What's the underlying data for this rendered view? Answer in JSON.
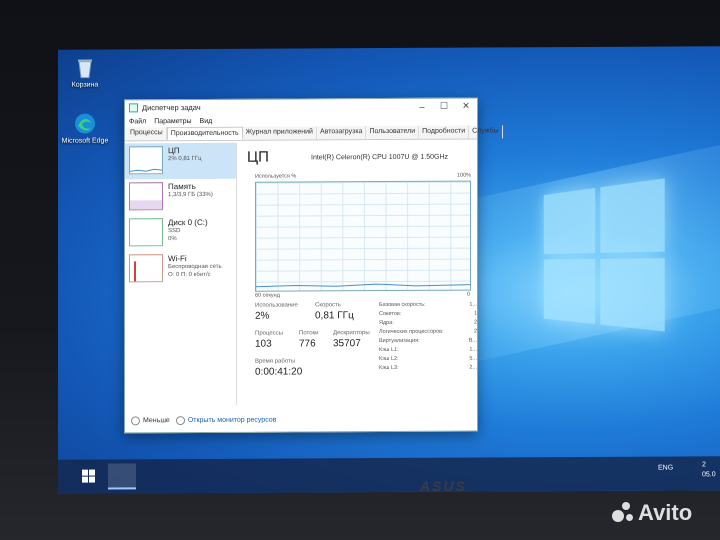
{
  "desktop": {
    "icons": [
      {
        "label": "Корзина"
      },
      {
        "label": "Microsoft Edge"
      }
    ]
  },
  "window": {
    "title": "Диспетчер задач",
    "menu": [
      "Файл",
      "Параметры",
      "Вид"
    ],
    "tabs": [
      "Процессы",
      "Производительность",
      "Журнал приложений",
      "Автозагрузка",
      "Пользователи",
      "Подробности",
      "Службы"
    ],
    "active_tab": "Производительность",
    "sidebar": [
      {
        "title": "ЦП",
        "line1": "2% 0,81 ГГц",
        "line2": ""
      },
      {
        "title": "Память",
        "line1": "1,3/3,9 ГБ (33%)",
        "line2": ""
      },
      {
        "title": "Диск 0 (C:)",
        "line1": "SSD",
        "line2": "0%"
      },
      {
        "title": "Wi-Fi",
        "line1": "Беспроводная сеть",
        "line2": "О: 0 П: 0 кбит/с"
      }
    ],
    "main": {
      "heading": "ЦП",
      "cpu_name": "Intel(R) Celeron(R) CPU 1007U @ 1.50GHz",
      "graph_label_left": "Используется %",
      "graph_label_right": "100%",
      "graph_x_left": "60 секунд",
      "graph_x_right": "0",
      "usage_label": "Использование",
      "usage_value": "2%",
      "speed_label": "Скорость",
      "speed_value": "0,81 ГГц",
      "processes_label": "Процессы",
      "processes_value": "103",
      "threads_label": "Потоки",
      "threads_value": "776",
      "handles_label": "Дескрипторы",
      "handles_value": "35707",
      "uptime_label": "Время работы",
      "uptime_value": "0:00:41:20",
      "specs": [
        {
          "k": "Базовая скорость:",
          "v": "1..."
        },
        {
          "k": "Сокетов:",
          "v": "1"
        },
        {
          "k": "Ядра:",
          "v": "2"
        },
        {
          "k": "Логических процессоров:",
          "v": "2"
        },
        {
          "k": "Виртуализация:",
          "v": "В..."
        },
        {
          "k": "Кэш L1:",
          "v": "1..."
        },
        {
          "k": "Кэш L2:",
          "v": "5..."
        },
        {
          "k": "Кэш L3:",
          "v": "2..."
        }
      ]
    },
    "footer": {
      "less": "Меньше",
      "monitor": "Открыть монитор ресурсов"
    }
  },
  "taskbar": {
    "tray_lang": "ENG",
    "time": "2",
    "date": "05.0"
  },
  "brand": "ASUS",
  "watermark": "Avito",
  "colors": {
    "accent": "#1a5fb4",
    "selected": "#cce4f7",
    "graph_border": "#77aabb"
  }
}
